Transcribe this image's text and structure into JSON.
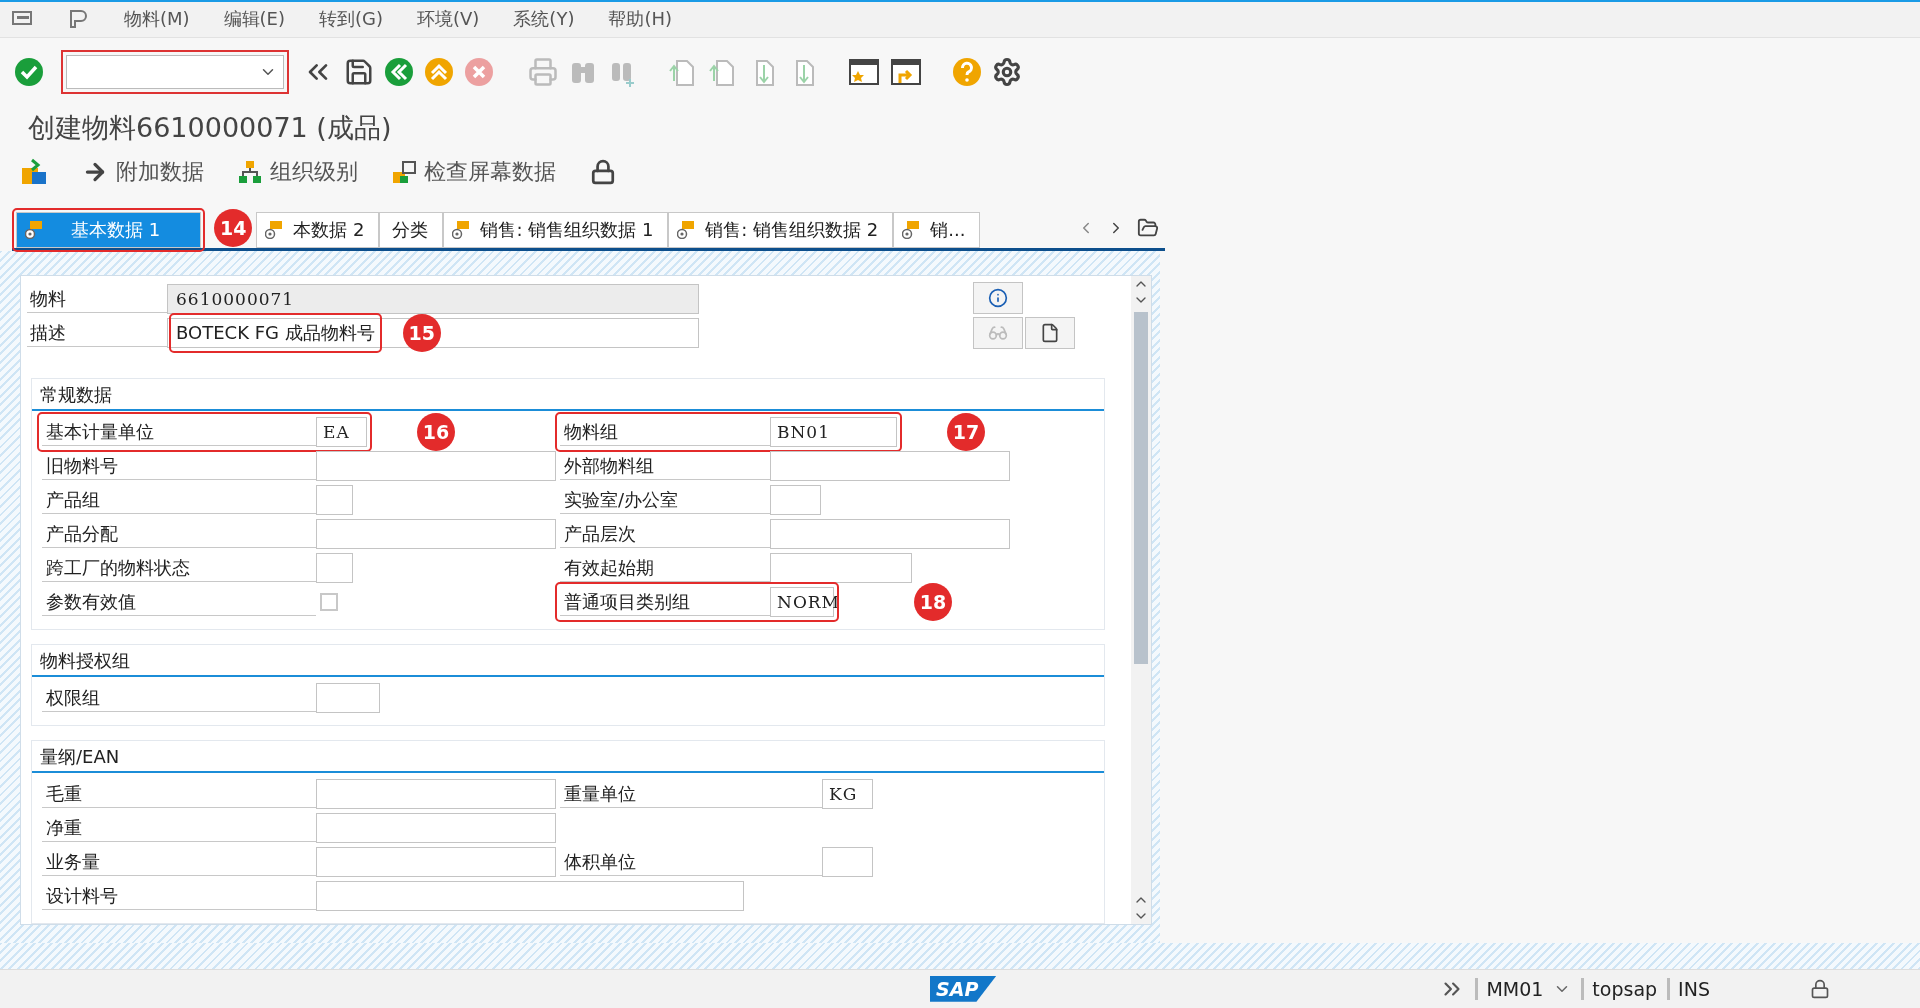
{
  "menu_bar": {
    "items": [
      "物料(M)",
      "编辑(E)",
      "转到(G)",
      "环境(V)",
      "系统(Y)",
      "帮助(H)"
    ]
  },
  "title": "创建物料6610000071 (成品)",
  "app_toolbar": {
    "buttons": [
      {
        "kind": "arrow",
        "label": "附加数据"
      },
      {
        "kind": "org",
        "label": "组织级别"
      },
      {
        "kind": "check",
        "label": "检查屏幕数据"
      }
    ]
  },
  "tabs": [
    {
      "label": "基本数据 1",
      "kind": "icon",
      "selected": true,
      "highlighted": true,
      "callout": "14"
    },
    {
      "label": "本数据 2",
      "kind": "icon",
      "selected": false
    },
    {
      "label": "分类",
      "kind": "plain",
      "selected": false
    },
    {
      "label": "销售: 销售组织数据 1",
      "kind": "icon",
      "selected": false
    },
    {
      "label": "销售: 销售组织数据 2",
      "kind": "icon",
      "selected": false
    },
    {
      "label": "销...",
      "kind": "icon",
      "selected": false
    }
  ],
  "header_fields": [
    {
      "label": "物料",
      "value": "6610000071",
      "kind": "display"
    },
    {
      "label": "描述",
      "value": "BOTECK FG 成品物料号",
      "kind": "input",
      "highlighted": true,
      "callout": "15"
    }
  ],
  "groups": [
    {
      "title": "常规数据",
      "kind": "general",
      "rows": [
        {
          "left": {
            "label": "基本计量单位",
            "value": "EA",
            "kind": "short",
            "highlighted": true,
            "callout": "16"
          },
          "right": {
            "label": "物料组",
            "value": "BN01",
            "kind": "long",
            "highlighted": true,
            "callout": "17"
          }
        },
        {
          "left": {
            "label": "旧物料号",
            "kind": "full"
          },
          "right": {
            "label": "外部物料组",
            "kind": "full"
          }
        },
        {
          "left": {
            "label": "产品组",
            "kind": "tiny"
          },
          "right": {
            "label": "实验室/办公室",
            "kind": "short"
          }
        },
        {
          "left": {
            "label": "产品分配",
            "kind": "full"
          },
          "right": {
            "label": "产品层次",
            "kind": "full"
          }
        },
        {
          "left": {
            "label": "跨工厂的物料状态",
            "kind": "tiny"
          },
          "right": {
            "label": "有效起始期",
            "kind": "date"
          }
        },
        {
          "left": {
            "label": "参数有效值",
            "kind": "checkbox",
            "checked": false
          },
          "right": {
            "label": "普通项目类别组",
            "value": "NORM",
            "kind": "medium",
            "highlighted": true,
            "callout": "18"
          }
        }
      ]
    },
    {
      "title": "物料授权组",
      "kind": "general",
      "rows": [
        {
          "left": {
            "label": "权限组",
            "kind": "medium"
          }
        }
      ]
    },
    {
      "title": "量纲/EAN",
      "kind": "dimensions",
      "rows": [
        {
          "left": {
            "label": "毛重",
            "kind": "full"
          },
          "right": {
            "label": "重量单位",
            "value": "KG",
            "kind": "short"
          }
        },
        {
          "left": {
            "label": "净重",
            "kind": "full"
          }
        },
        {
          "left": {
            "label": "业务量",
            "kind": "full"
          },
          "right": {
            "label": "体积单位",
            "kind": "short"
          }
        },
        {
          "left": {
            "label": "设计料号",
            "kind": "extra"
          }
        }
      ]
    }
  ],
  "status_bar": {
    "logo": "SAP",
    "transaction": "MM01",
    "user": "topsap",
    "mode": "INS"
  }
}
